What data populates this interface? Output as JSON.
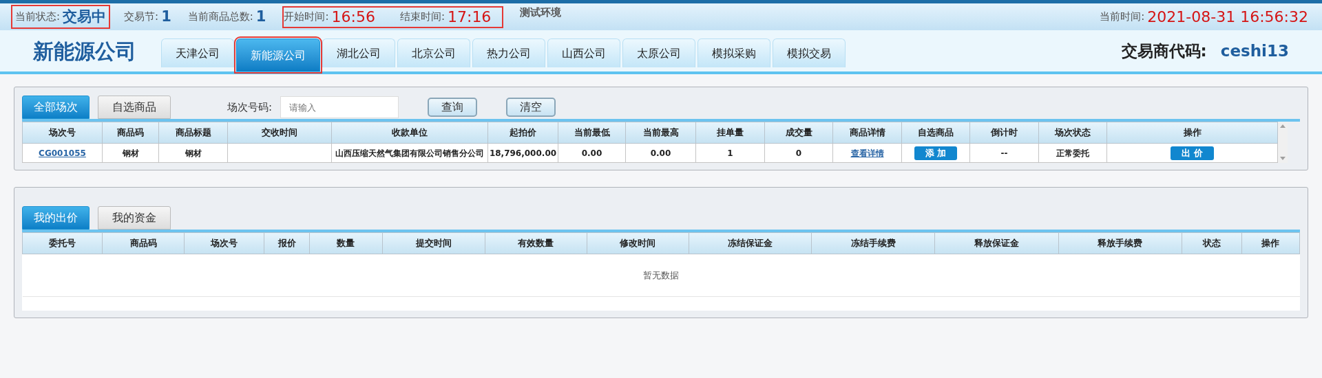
{
  "status_bar": {
    "state": {
      "label": "当前状态:",
      "value": "交易中",
      "highlighted": true
    },
    "session": {
      "label": "交易节:",
      "value": "1"
    },
    "count": {
      "label": "当前商品总数:",
      "value": "1"
    },
    "times": {
      "highlighted": true,
      "start_label": "开始时间:",
      "start": "16:56",
      "end_label": "结束时间:",
      "end": "17:16"
    },
    "env": "测试环境",
    "clock": {
      "label": "当前时间:",
      "value": "2021-08-31 16:56:32"
    }
  },
  "header": {
    "company": "新能源公司",
    "tabs": [
      {
        "label": "天津公司",
        "selected": false,
        "highlighted": false
      },
      {
        "label": "新能源公司",
        "selected": true,
        "highlighted": true
      },
      {
        "label": "湖北公司",
        "selected": false,
        "highlighted": false
      },
      {
        "label": "北京公司",
        "selected": false,
        "highlighted": false
      },
      {
        "label": "热力公司",
        "selected": false,
        "highlighted": false
      },
      {
        "label": "山西公司",
        "selected": false,
        "highlighted": false
      },
      {
        "label": "太原公司",
        "selected": false,
        "highlighted": false
      },
      {
        "label": "模拟采购",
        "selected": false,
        "highlighted": false
      },
      {
        "label": "模拟交易",
        "selected": false,
        "highlighted": false
      }
    ],
    "trader_label": "交易商代码:",
    "trader_code": "ceshi13"
  },
  "market": {
    "tabs": [
      {
        "label": "全部场次",
        "selected": true
      },
      {
        "label": "自选商品",
        "selected": false
      }
    ],
    "search": {
      "label": "场次号码:",
      "placeholder": "请输入"
    },
    "buttons": [
      "查询",
      "清空"
    ],
    "columns": [
      "场次号",
      "商品码",
      "商品标题",
      "交收时间",
      "收款单位",
      "起拍价",
      "当前最低",
      "当前最高",
      "挂单量",
      "成交量",
      "商品详情",
      "自选商品",
      "倒计时",
      "场次状态",
      "操作"
    ],
    "rows": [
      {
        "cells": [
          {
            "kind": "link",
            "text": "CG001055"
          },
          {
            "kind": "text",
            "text": "钢材"
          },
          {
            "kind": "text",
            "text": "钢材"
          },
          {
            "kind": "text",
            "text": ""
          },
          {
            "kind": "text",
            "text": "山西压缩天然气集团有限公司销售分公司"
          },
          {
            "kind": "text",
            "text": "18,796,000.00"
          },
          {
            "kind": "text",
            "text": "0.00"
          },
          {
            "kind": "text",
            "text": "0.00"
          },
          {
            "kind": "text",
            "text": "1"
          },
          {
            "kind": "text",
            "text": "0"
          },
          {
            "kind": "link",
            "text": "查看详情"
          },
          {
            "kind": "button",
            "text": "添 加"
          },
          {
            "kind": "text",
            "text": "--"
          },
          {
            "kind": "text",
            "text": "正常委托"
          },
          {
            "kind": "button",
            "text": "出 价"
          }
        ]
      }
    ]
  },
  "orders": {
    "tabs": [
      {
        "label": "我的出价",
        "selected": true
      },
      {
        "label": "我的资金",
        "selected": false
      }
    ],
    "columns": [
      "委托号",
      "商品码",
      "场次号",
      "报价",
      "数量",
      "提交时间",
      "有效数量",
      "修改时间",
      "冻结保证金",
      "冻结手续费",
      "释放保证金",
      "释放手续费",
      "状态",
      "操作"
    ],
    "empty": "暂无数据"
  }
}
